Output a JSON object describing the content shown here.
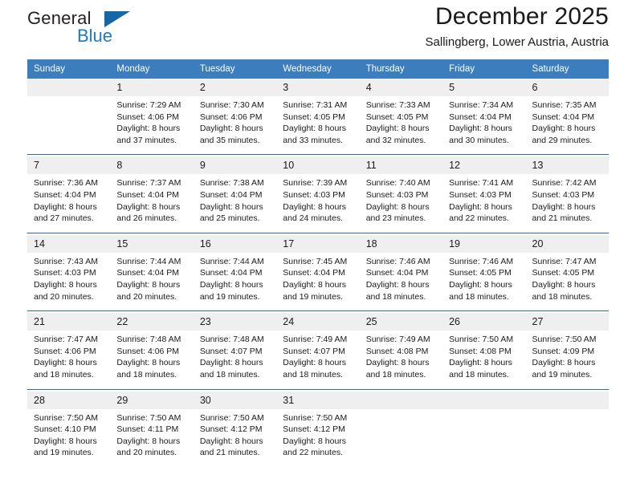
{
  "brand": {
    "name_part1": "General",
    "name_part2": "Blue",
    "triangle_icon": "triangle-icon"
  },
  "header": {
    "title": "December 2025",
    "subtitle": "Sallingberg, Lower Austria, Austria"
  },
  "colors": {
    "header_blue": "#3b7dbd",
    "separator_blue": "#2c6aa8",
    "daynum_band": "#efefef",
    "logo_blue": "#1f79c3",
    "logo_dark": "#231f20"
  },
  "calendar": {
    "weekdays": [
      "Sunday",
      "Monday",
      "Tuesday",
      "Wednesday",
      "Thursday",
      "Friday",
      "Saturday"
    ],
    "weeks": [
      [
        {
          "day": "",
          "lines": []
        },
        {
          "day": "1",
          "lines": [
            "Sunrise: 7:29 AM",
            "Sunset: 4:06 PM",
            "Daylight: 8 hours",
            "and 37 minutes."
          ]
        },
        {
          "day": "2",
          "lines": [
            "Sunrise: 7:30 AM",
            "Sunset: 4:06 PM",
            "Daylight: 8 hours",
            "and 35 minutes."
          ]
        },
        {
          "day": "3",
          "lines": [
            "Sunrise: 7:31 AM",
            "Sunset: 4:05 PM",
            "Daylight: 8 hours",
            "and 33 minutes."
          ]
        },
        {
          "day": "4",
          "lines": [
            "Sunrise: 7:33 AM",
            "Sunset: 4:05 PM",
            "Daylight: 8 hours",
            "and 32 minutes."
          ]
        },
        {
          "day": "5",
          "lines": [
            "Sunrise: 7:34 AM",
            "Sunset: 4:04 PM",
            "Daylight: 8 hours",
            "and 30 minutes."
          ]
        },
        {
          "day": "6",
          "lines": [
            "Sunrise: 7:35 AM",
            "Sunset: 4:04 PM",
            "Daylight: 8 hours",
            "and 29 minutes."
          ]
        }
      ],
      [
        {
          "day": "7",
          "lines": [
            "Sunrise: 7:36 AM",
            "Sunset: 4:04 PM",
            "Daylight: 8 hours",
            "and 27 minutes."
          ]
        },
        {
          "day": "8",
          "lines": [
            "Sunrise: 7:37 AM",
            "Sunset: 4:04 PM",
            "Daylight: 8 hours",
            "and 26 minutes."
          ]
        },
        {
          "day": "9",
          "lines": [
            "Sunrise: 7:38 AM",
            "Sunset: 4:04 PM",
            "Daylight: 8 hours",
            "and 25 minutes."
          ]
        },
        {
          "day": "10",
          "lines": [
            "Sunrise: 7:39 AM",
            "Sunset: 4:03 PM",
            "Daylight: 8 hours",
            "and 24 minutes."
          ]
        },
        {
          "day": "11",
          "lines": [
            "Sunrise: 7:40 AM",
            "Sunset: 4:03 PM",
            "Daylight: 8 hours",
            "and 23 minutes."
          ]
        },
        {
          "day": "12",
          "lines": [
            "Sunrise: 7:41 AM",
            "Sunset: 4:03 PM",
            "Daylight: 8 hours",
            "and 22 minutes."
          ]
        },
        {
          "day": "13",
          "lines": [
            "Sunrise: 7:42 AM",
            "Sunset: 4:03 PM",
            "Daylight: 8 hours",
            "and 21 minutes."
          ]
        }
      ],
      [
        {
          "day": "14",
          "lines": [
            "Sunrise: 7:43 AM",
            "Sunset: 4:03 PM",
            "Daylight: 8 hours",
            "and 20 minutes."
          ]
        },
        {
          "day": "15",
          "lines": [
            "Sunrise: 7:44 AM",
            "Sunset: 4:04 PM",
            "Daylight: 8 hours",
            "and 20 minutes."
          ]
        },
        {
          "day": "16",
          "lines": [
            "Sunrise: 7:44 AM",
            "Sunset: 4:04 PM",
            "Daylight: 8 hours",
            "and 19 minutes."
          ]
        },
        {
          "day": "17",
          "lines": [
            "Sunrise: 7:45 AM",
            "Sunset: 4:04 PM",
            "Daylight: 8 hours",
            "and 19 minutes."
          ]
        },
        {
          "day": "18",
          "lines": [
            "Sunrise: 7:46 AM",
            "Sunset: 4:04 PM",
            "Daylight: 8 hours",
            "and 18 minutes."
          ]
        },
        {
          "day": "19",
          "lines": [
            "Sunrise: 7:46 AM",
            "Sunset: 4:05 PM",
            "Daylight: 8 hours",
            "and 18 minutes."
          ]
        },
        {
          "day": "20",
          "lines": [
            "Sunrise: 7:47 AM",
            "Sunset: 4:05 PM",
            "Daylight: 8 hours",
            "and 18 minutes."
          ]
        }
      ],
      [
        {
          "day": "21",
          "lines": [
            "Sunrise: 7:47 AM",
            "Sunset: 4:06 PM",
            "Daylight: 8 hours",
            "and 18 minutes."
          ]
        },
        {
          "day": "22",
          "lines": [
            "Sunrise: 7:48 AM",
            "Sunset: 4:06 PM",
            "Daylight: 8 hours",
            "and 18 minutes."
          ]
        },
        {
          "day": "23",
          "lines": [
            "Sunrise: 7:48 AM",
            "Sunset: 4:07 PM",
            "Daylight: 8 hours",
            "and 18 minutes."
          ]
        },
        {
          "day": "24",
          "lines": [
            "Sunrise: 7:49 AM",
            "Sunset: 4:07 PM",
            "Daylight: 8 hours",
            "and 18 minutes."
          ]
        },
        {
          "day": "25",
          "lines": [
            "Sunrise: 7:49 AM",
            "Sunset: 4:08 PM",
            "Daylight: 8 hours",
            "and 18 minutes."
          ]
        },
        {
          "day": "26",
          "lines": [
            "Sunrise: 7:50 AM",
            "Sunset: 4:08 PM",
            "Daylight: 8 hours",
            "and 18 minutes."
          ]
        },
        {
          "day": "27",
          "lines": [
            "Sunrise: 7:50 AM",
            "Sunset: 4:09 PM",
            "Daylight: 8 hours",
            "and 19 minutes."
          ]
        }
      ],
      [
        {
          "day": "28",
          "lines": [
            "Sunrise: 7:50 AM",
            "Sunset: 4:10 PM",
            "Daylight: 8 hours",
            "and 19 minutes."
          ]
        },
        {
          "day": "29",
          "lines": [
            "Sunrise: 7:50 AM",
            "Sunset: 4:11 PM",
            "Daylight: 8 hours",
            "and 20 minutes."
          ]
        },
        {
          "day": "30",
          "lines": [
            "Sunrise: 7:50 AM",
            "Sunset: 4:12 PM",
            "Daylight: 8 hours",
            "and 21 minutes."
          ]
        },
        {
          "day": "31",
          "lines": [
            "Sunrise: 7:50 AM",
            "Sunset: 4:12 PM",
            "Daylight: 8 hours",
            "and 22 minutes."
          ]
        },
        {
          "day": "",
          "lines": []
        },
        {
          "day": "",
          "lines": []
        },
        {
          "day": "",
          "lines": []
        }
      ]
    ]
  }
}
